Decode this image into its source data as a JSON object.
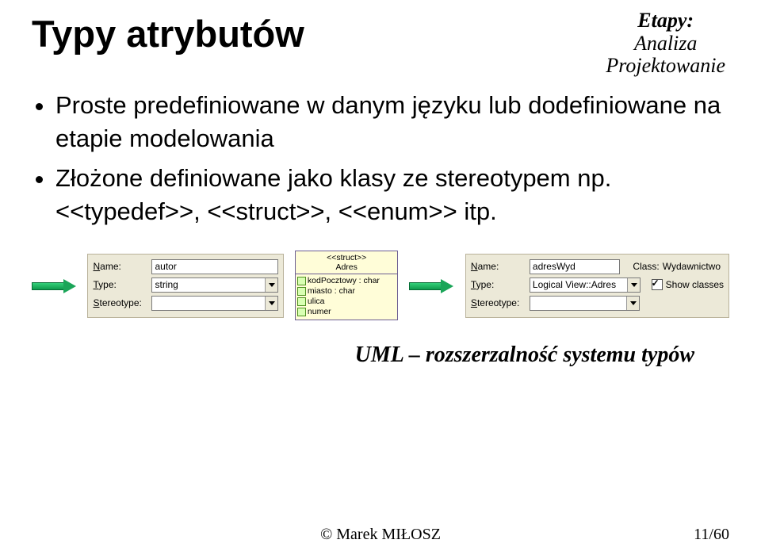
{
  "title": "Typy atrybutów",
  "stage": {
    "line1": "Etapy:",
    "line2": "Analiza",
    "line3": "Projektowanie"
  },
  "bullets": [
    "Proste predefiniowane w danym języku lub dodefiniowane na etapie modelowania",
    "Złożone definiowane jako klasy ze stereotypem np.<<typedef>>, <<struct>>, <<enum>> itp."
  ],
  "panelLeft": {
    "name": {
      "label_pre": "N",
      "label_rest": "ame:",
      "value": "autor"
    },
    "type": {
      "label_pre": "T",
      "label_rest": "ype:",
      "value": "string"
    },
    "stereotype": {
      "label_pre": "S",
      "label_rest": "tereotype:",
      "value": ""
    }
  },
  "umlStruct": {
    "stereotype": "<<struct>>",
    "name": "Adres",
    "attrs": [
      "kodPocztowy : char",
      "miasto : char",
      "ulica",
      "numer"
    ]
  },
  "panelRight": {
    "name": {
      "label_pre": "N",
      "label_rest": "ame:",
      "value": "adresWyd"
    },
    "class": {
      "label": "Class:",
      "value": "Wydawnictwo"
    },
    "type": {
      "label_pre": "T",
      "label_rest": "ype:",
      "value": "Logical View::Adres"
    },
    "showClasses": {
      "label_pre": "S",
      "label_rest": "how classes",
      "checked": true
    },
    "stereotype": {
      "label_pre": "S",
      "label_rest": "tereotype:",
      "value": ""
    }
  },
  "slogan": "UML – rozszerzalność systemu typów",
  "footer": "© Marek MIŁOSZ",
  "pager": "11/60"
}
